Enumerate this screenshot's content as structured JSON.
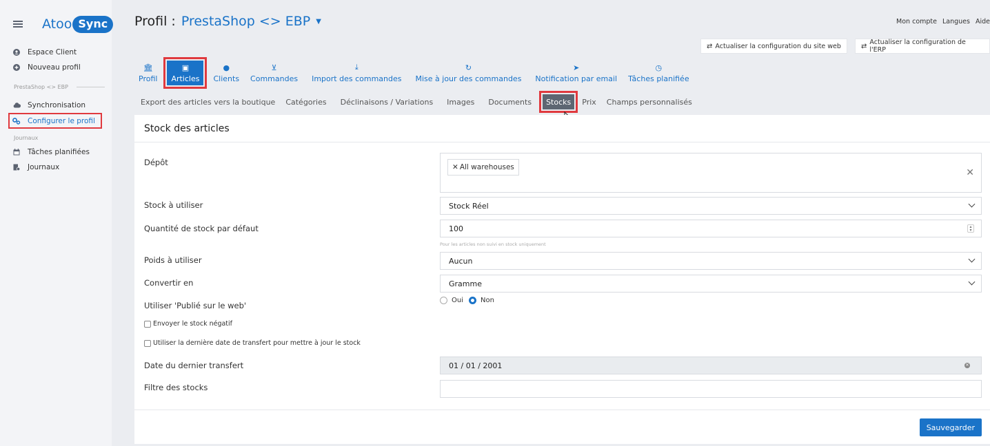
{
  "brand": {
    "name_part1": "Atoo",
    "name_part2": "Sync"
  },
  "sidebar": {
    "items": [
      {
        "label": "Espace Client",
        "icon": "user-circle-icon"
      },
      {
        "label": "Nouveau profil",
        "icon": "plus-circle-icon"
      }
    ],
    "section1": "PrestaShop <> EBP",
    "items2": [
      {
        "label": "Synchronisation",
        "icon": "cloud-icon"
      },
      {
        "label": "Configurer le profil",
        "icon": "cogs-icon"
      }
    ],
    "section2": "Journaux",
    "items3": [
      {
        "label": "Tâches planifiées",
        "icon": "calendar-icon"
      },
      {
        "label": "Journaux",
        "icon": "log-icon"
      }
    ]
  },
  "header": {
    "title_prefix": "Profil :",
    "profile_name": "PrestaShop <> EBP",
    "top_links": [
      "Mon compte",
      "Langues",
      "Aide"
    ],
    "refresh_site": "Actualiser la configuration du site web",
    "refresh_erp": "Actualiser la configuration de l'ERP"
  },
  "main_tabs": [
    {
      "label": "Profil",
      "icon": "bank-icon"
    },
    {
      "label": "Articles",
      "icon": "box-icon",
      "active": true
    },
    {
      "label": "Clients",
      "icon": "user-icon"
    },
    {
      "label": "Commandes",
      "icon": "cart-icon"
    },
    {
      "label": "Import des commandes",
      "icon": "download-icon"
    },
    {
      "label": "Mise à jour des commandes",
      "icon": "refresh-icon"
    },
    {
      "label": "Notification par email",
      "icon": "send-icon"
    },
    {
      "label": "Tâches planifiée",
      "icon": "clock-icon"
    }
  ],
  "sub_tabs": [
    "Export des articles vers la boutique",
    "Catégories",
    "Déclinaisons / Variations",
    "Images",
    "Documents",
    "Stocks",
    "Prix",
    "Champs personnalisés"
  ],
  "card": {
    "title": "Stock des articles",
    "depot_label": "Dépôt",
    "depot_tag": "All warehouses",
    "stock_label": "Stock à utiliser",
    "stock_value": "Stock Réel",
    "qty_label": "Quantité de stock par défaut",
    "qty_value": "100",
    "qty_help": "Pour les articles non suivi en stock uniquement",
    "weight_label": "Poids à utiliser",
    "weight_value": "Aucun",
    "convert_label": "Convertir en",
    "convert_value": "Gramme",
    "publish_label": "Utiliser 'Publié sur le web'",
    "radio_yes": "Oui",
    "radio_no": "Non",
    "negative_label": "Envoyer le stock négatif",
    "lastdate_label": "Utiliser la dernière date de transfert pour mettre à jour le stock",
    "transfer_label": "Date du dernier transfert",
    "transfer_value": "01 / 01 / 2001",
    "filter_label": "Filtre des stocks",
    "filter_value": "",
    "save": "Sauvegarder"
  }
}
